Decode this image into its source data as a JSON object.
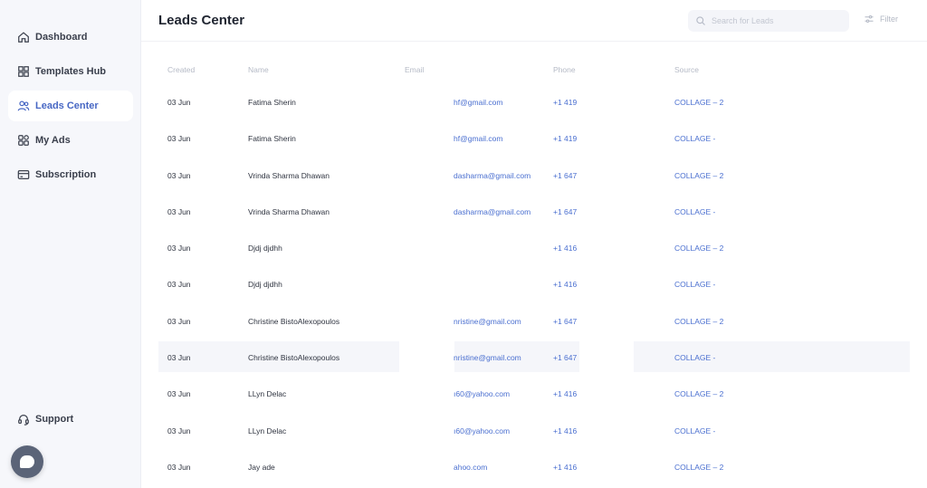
{
  "sidebar": {
    "items": [
      {
        "label": "Dashboard",
        "icon": "home-icon"
      },
      {
        "label": "Templates Hub",
        "icon": "grid-icon"
      },
      {
        "label": "Leads Center",
        "icon": "users-icon",
        "active": true
      },
      {
        "label": "My Ads",
        "icon": "apps-icon"
      },
      {
        "label": "Subscription",
        "icon": "card-icon"
      }
    ],
    "support_label": "Support"
  },
  "header": {
    "title": "Leads Center",
    "search_placeholder": "Search for Leads",
    "filter_label": "Filter"
  },
  "table": {
    "columns": [
      "Created",
      "Name",
      "Email",
      "Phone",
      "Source"
    ],
    "rows": [
      {
        "created": "03 Jun",
        "name": "Fatima Sherin",
        "email": "hf@gmail.com",
        "phone": "+1 419",
        "source": "COLLAGE – 2"
      },
      {
        "created": "03 Jun",
        "name": "Fatima Sherin",
        "email": "hf@gmail.com",
        "phone": "+1 419",
        "source": "COLLAGE -"
      },
      {
        "created": "03 Jun",
        "name": "Vrinda Sharma Dhawan",
        "email": "dasharma@gmail.com",
        "phone": "+1 647",
        "source": "COLLAGE – 2"
      },
      {
        "created": "03 Jun",
        "name": "Vrinda Sharma Dhawan",
        "email": "dasharma@gmail.com",
        "phone": "+1 647",
        "source": "COLLAGE -"
      },
      {
        "created": "03 Jun",
        "name": "Djdj djdhh",
        "email": "",
        "phone": "+1 416",
        "source": "COLLAGE – 2"
      },
      {
        "created": "03 Jun",
        "name": "Djdj djdhh",
        "email": "",
        "phone": "+1 416",
        "source": "COLLAGE -"
      },
      {
        "created": "03 Jun",
        "name": "Christine BistoAlexopoulos",
        "email": "nristine@gmail.com",
        "phone": "+1 647",
        "source": "COLLAGE – 2"
      },
      {
        "created": "03 Jun",
        "name": "Christine BistoAlexopoulos",
        "email": "nristine@gmail.com",
        "phone": "+1 647",
        "source": "COLLAGE -"
      },
      {
        "created": "03 Jun",
        "name": "LLyn Delac",
        "email": "ı60@yahoo.com",
        "phone": "+1 416",
        "source": "COLLAGE – 2"
      },
      {
        "created": "03 Jun",
        "name": "LLyn Delac",
        "email": "ı60@yahoo.com",
        "phone": "+1 416",
        "source": "COLLAGE -"
      },
      {
        "created": "03 Jun",
        "name": "Jay ade",
        "email": "ahoo.com",
        "phone": "+1 416",
        "source": "COLLAGE – 2"
      }
    ]
  },
  "colors": {
    "accent": "#4a6fd0",
    "sidebar_bg": "#f6f7fb",
    "row_highlight": "#f5f6fa"
  }
}
